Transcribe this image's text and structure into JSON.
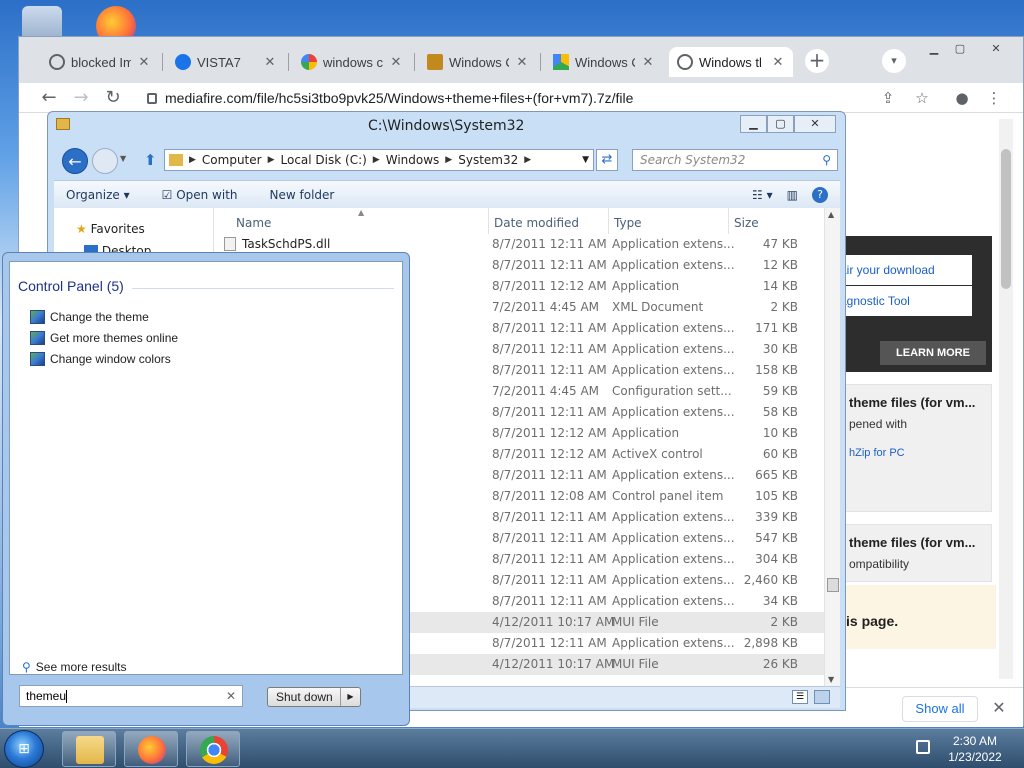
{
  "desktop": {
    "icons": [
      "recycle-bin-icon",
      "firefox-icon",
      "vista-icon"
    ]
  },
  "chrome": {
    "tabs": [
      {
        "label": "blocked Im",
        "icon": "globe-icon",
        "color": "#5f6368"
      },
      {
        "label": "VISTA7",
        "icon": "vista-icon",
        "color": "#1a73e8"
      },
      {
        "label": "windows cl",
        "icon": "google-icon",
        "color": "#4285f4"
      },
      {
        "label": "Windows C",
        "icon": "site-icon",
        "color": "#c28a1e"
      },
      {
        "label": "Windows C",
        "icon": "drive-icon",
        "color": "#34a853"
      },
      {
        "label": "Windows tl",
        "icon": "globe-icon",
        "color": "#5f6368"
      }
    ],
    "url": "mediafire.com/file/hc5si3tbo9pvk25/Windows+theme+files+(for+vm7).7z/file"
  },
  "webpage": {
    "ad_links": [
      "air your download",
      "agnostic Tool"
    ],
    "learn_more": "LEARN MORE",
    "file_cards": [
      {
        "title": "theme files (for vm...",
        "sub": "pened with",
        "link": "hZip for PC"
      },
      {
        "title": "theme files (for vm...",
        "sub": "ompatibility",
        "link": ""
      }
    ],
    "notice": "is page.",
    "download_bar": {
      "show_all": "Show all"
    }
  },
  "explorer": {
    "title": "C:\\Windows\\System32",
    "path": [
      "Computer",
      "Local Disk (C:)",
      "Windows",
      "System32"
    ],
    "search_placeholder": "Search System32",
    "commands": {
      "organize": "Organize",
      "open_with": "Open with",
      "new_folder": "New folder"
    },
    "columns": {
      "name": "Name",
      "date": "Date modified",
      "type": "Type",
      "size": "Size"
    },
    "nav": {
      "favorites": "Favorites",
      "desktop": "Desktop"
    },
    "rows": [
      {
        "name": "TaskSchdPS.dll",
        "date": "8/7/2011 12:11 AM",
        "type": "Application extens...",
        "size": "47 KB"
      },
      {
        "name": "",
        "date": "8/7/2011 12:11 AM",
        "type": "Application extens...",
        "size": "12 KB"
      },
      {
        "name": "",
        "date": "8/7/2011 12:12 AM",
        "type": "Application",
        "size": "14 KB"
      },
      {
        "name": "",
        "date": "7/2/2011 4:45 AM",
        "type": "XML Document",
        "size": "2 KB"
      },
      {
        "name": "",
        "date": "8/7/2011 12:11 AM",
        "type": "Application extens...",
        "size": "171 KB"
      },
      {
        "name": "",
        "date": "8/7/2011 12:11 AM",
        "type": "Application extens...",
        "size": "30 KB"
      },
      {
        "name": "",
        "date": "8/7/2011 12:11 AM",
        "type": "Application extens...",
        "size": "158 KB"
      },
      {
        "name": "",
        "date": "7/2/2011 4:45 AM",
        "type": "Configuration sett...",
        "size": "59 KB"
      },
      {
        "name": "",
        "date": "8/7/2011 12:11 AM",
        "type": "Application extens...",
        "size": "58 KB"
      },
      {
        "name": "",
        "date": "8/7/2011 12:12 AM",
        "type": "Application",
        "size": "10 KB"
      },
      {
        "name": "",
        "date": "8/7/2011 12:12 AM",
        "type": "ActiveX control",
        "size": "60 KB"
      },
      {
        "name": "",
        "date": "8/7/2011 12:11 AM",
        "type": "Application extens...",
        "size": "665 KB"
      },
      {
        "name": "",
        "date": "8/7/2011 12:08 AM",
        "type": "Control panel item",
        "size": "105 KB"
      },
      {
        "name": "",
        "date": "8/7/2011 12:11 AM",
        "type": "Application extens...",
        "size": "339 KB"
      },
      {
        "name": "",
        "date": "8/7/2011 12:11 AM",
        "type": "Application extens...",
        "size": "547 KB"
      },
      {
        "name": "",
        "date": "8/7/2011 12:11 AM",
        "type": "Application extens...",
        "size": "304 KB"
      },
      {
        "name": "",
        "date": "8/7/2011 12:11 AM",
        "type": "Application extens...",
        "size": "2,460 KB"
      },
      {
        "name": "",
        "date": "8/7/2011 12:11 AM",
        "type": "Application extens...",
        "size": "34 KB"
      },
      {
        "name": "",
        "date": "4/12/2011 10:17 AM",
        "type": "MUI File",
        "size": "2 KB",
        "selected": true
      },
      {
        "name": "",
        "date": "8/7/2011 12:11 AM",
        "type": "Application extens...",
        "size": "2,898 KB"
      },
      {
        "name": "",
        "date": "4/12/2011 10:17 AM",
        "type": "MUI File",
        "size": "26 KB",
        "selected": true
      }
    ]
  },
  "startmenu": {
    "heading": "Control Panel (5)",
    "items": [
      "Change the theme",
      "Get more themes online",
      "Change window colors"
    ],
    "see_more": "See more results",
    "search_value": "themeu",
    "shutdown": "Shut down"
  },
  "taskbar": {
    "apps": [
      {
        "icon": "explorer-folder-icon",
        "color": "#e3b64a"
      },
      {
        "icon": "firefox-icon",
        "color": "#ff7139"
      },
      {
        "icon": "chrome-icon",
        "color": "#4285f4"
      }
    ],
    "time": "2:30 AM",
    "date": "1/23/2022"
  }
}
